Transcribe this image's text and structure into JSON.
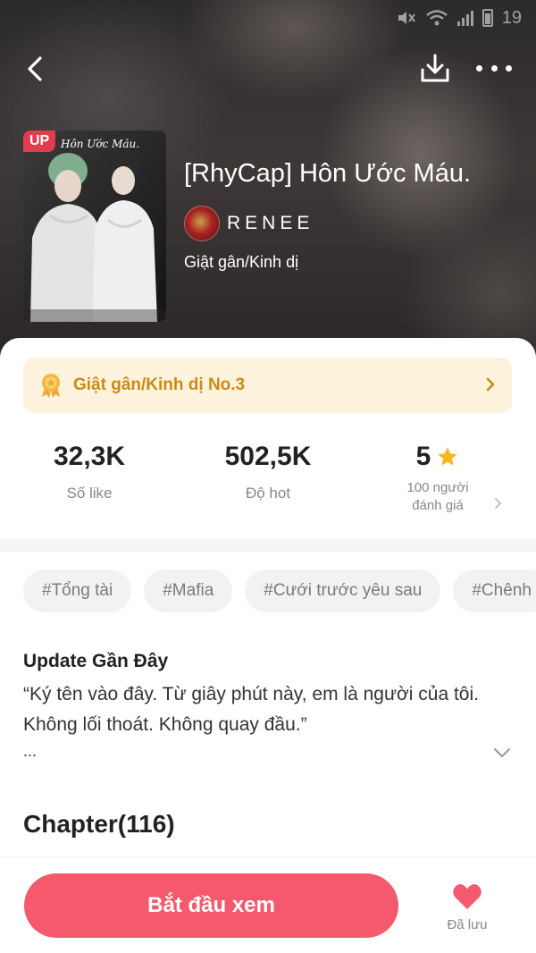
{
  "status_bar": {
    "battery": "19"
  },
  "book": {
    "title": "[RhyCap] Hôn Ước Máu.",
    "cover_badge": "UP",
    "cover_title": "Hôn Ước Máu.",
    "author": "RENEE",
    "genre": "Giật gân/Kinh dị"
  },
  "rank": {
    "label": "Giật gân/Kinh dị No.3",
    "color": "#c98b16"
  },
  "stats": {
    "likes": {
      "value": "32,3K",
      "label": "Số like"
    },
    "hot": {
      "value": "502,5K",
      "label": "Độ hot"
    },
    "rating": {
      "value": "5",
      "label_line1": "100 người",
      "label_line2": "đánh giá"
    }
  },
  "tags": [
    "#Tổng tài",
    "#Mafia",
    "#Cưới trước yêu sau",
    "#Chênh"
  ],
  "update": {
    "title": "Update Gần Đây",
    "text": "“Ký tên vào đây. Từ giây phút này, em là người của tôi. Không lối thoát. Không quay đầu.”",
    "ellipsis": "..."
  },
  "chapters": {
    "title": "Chapter(116)"
  },
  "bottom": {
    "start_label": "Bắt đầu xem",
    "save_label": "Đã lưu",
    "accent": "#f4596d"
  },
  "icons": {
    "back": "chevron-left-icon",
    "download": "download-icon",
    "more": "more-icon",
    "medal": "medal-icon",
    "star": "star-icon",
    "heart": "heart-icon"
  }
}
